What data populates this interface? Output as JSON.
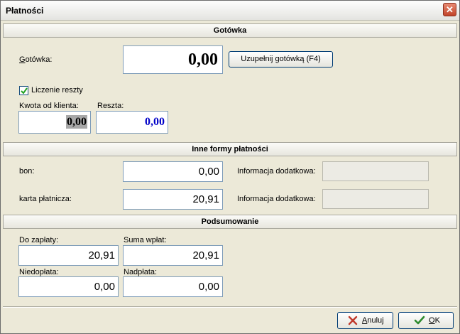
{
  "window": {
    "title": "Płatności",
    "close": "✕"
  },
  "sections": {
    "cash": "Gotówka",
    "other": "Inne formy płatności",
    "summary": "Podsumowanie"
  },
  "cash": {
    "label": "Gotówka:",
    "value": "0,00",
    "fill_button": "Uzupełnij gotówką (F4)",
    "change_checkbox_label": "Liczenie reszty",
    "change_checked": true,
    "client_amount_label": "Kwota od klienta:",
    "client_amount_value": "0,00",
    "change_label": "Reszta:",
    "change_value": "0,00",
    "change_color": "#0000c8"
  },
  "other": {
    "rows": [
      {
        "label": "bon:",
        "value": "0,00",
        "info_label": "Informacja dodatkowa:",
        "info_value": ""
      },
      {
        "label": "karta płatnicza:",
        "value": "20,91",
        "info_label": "Informacja dodatkowa:",
        "info_value": ""
      }
    ]
  },
  "summary": {
    "to_pay_label": "Do zapłaty:",
    "to_pay_value": "20,91",
    "paid_sum_label": "Suma wpłat:",
    "paid_sum_value": "20,91",
    "underpaid_label": "Niedopłata:",
    "underpaid_value": "0,00",
    "overpaid_label": "Nadpłata:",
    "overpaid_value": "0,00"
  },
  "footer": {
    "cancel": "Anuluj",
    "ok": "OK"
  },
  "colors": {
    "cancel_icon": "#c0392b",
    "ok_icon": "#2e8b2e"
  }
}
